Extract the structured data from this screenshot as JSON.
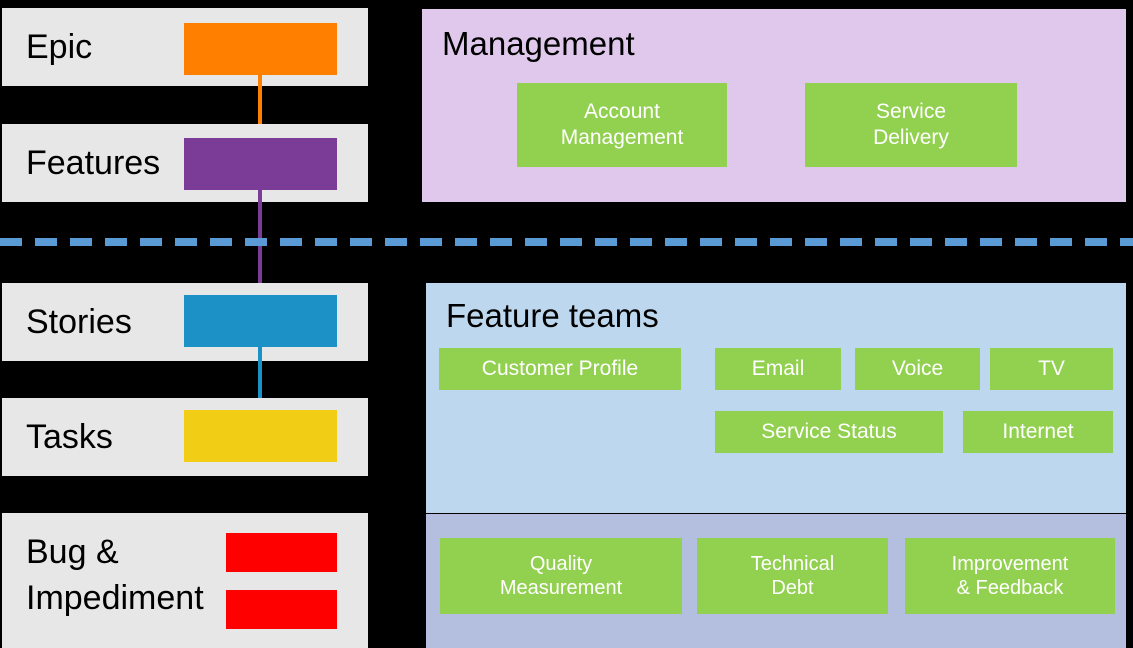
{
  "colors": {
    "background": "#000000",
    "card_bg": "#E7E7E7",
    "green_box": "#92D050",
    "management_panel": "#E0C8ED",
    "feature_teams_panel": "#BDD7EE",
    "support_panel": "#B4BEDE",
    "divider": "#5B9BD5",
    "epic": "#FF7F00",
    "features": "#7A3C96",
    "stories": "#1B91C6",
    "tasks": "#F2CD16",
    "bug": "#FF0000"
  },
  "backlog": {
    "levels": [
      {
        "label": "Epic",
        "swatch_color": "#FF7F00",
        "swatch_name": "epic-swatch"
      },
      {
        "label": "Features",
        "swatch_color": "#7A3C96",
        "swatch_name": "features-swatch"
      },
      {
        "label": "Stories",
        "swatch_color": "#1B91C6",
        "swatch_name": "stories-swatch"
      },
      {
        "label": "Tasks",
        "swatch_color": "#F2CD16",
        "swatch_name": "tasks-swatch"
      },
      {
        "label_line1": "Bug &",
        "label_line2": "Impediment",
        "swatch_color": "#FF0000",
        "swatch_name": "bug-impediment-swatch"
      }
    ]
  },
  "management": {
    "title": "Management",
    "teams": [
      {
        "line1": "Account",
        "line2": "Management"
      },
      {
        "line1": "Service",
        "line2": "Delivery"
      }
    ]
  },
  "feature_teams": {
    "title": "Feature teams",
    "teams": [
      {
        "label": "Customer Profile"
      },
      {
        "label": "Email"
      },
      {
        "label": "Voice"
      },
      {
        "label": "TV"
      },
      {
        "label": "Service Status"
      },
      {
        "label": "Internet"
      }
    ]
  },
  "support_teams": {
    "teams": [
      {
        "line1": "Quality",
        "line2": "Measurement"
      },
      {
        "line1": "Technical",
        "line2": "Debt"
      },
      {
        "line1": "Improvement",
        "line2": "& Feedback"
      }
    ]
  }
}
